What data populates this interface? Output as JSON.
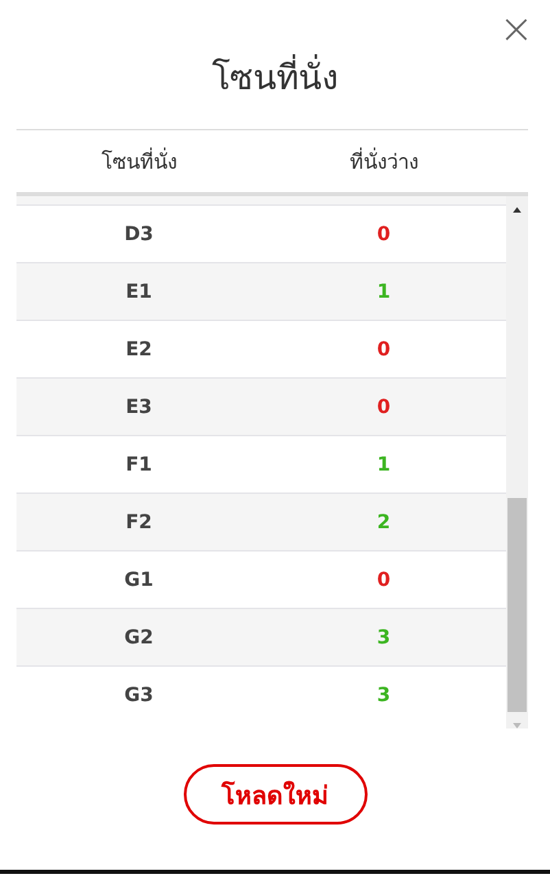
{
  "dialog": {
    "title": "โซนที่นั่ง",
    "close": "×"
  },
  "table": {
    "columns": [
      "โซนที่นั่ง",
      "ที่นั่งว่าง"
    ],
    "rows": [
      {
        "zone": "D3",
        "available": "0",
        "color": "#e02020"
      },
      {
        "zone": "E1",
        "available": "1",
        "color": "#3cb521"
      },
      {
        "zone": "E2",
        "available": "0",
        "color": "#e02020"
      },
      {
        "zone": "E3",
        "available": "0",
        "color": "#e02020"
      },
      {
        "zone": "F1",
        "available": "1",
        "color": "#3cb521"
      },
      {
        "zone": "F2",
        "available": "2",
        "color": "#3cb521"
      },
      {
        "zone": "G1",
        "available": "0",
        "color": "#e02020"
      },
      {
        "zone": "G2",
        "available": "3",
        "color": "#3cb521"
      },
      {
        "zone": "G3",
        "available": "3",
        "color": "#3cb521"
      }
    ]
  },
  "reload_button": "โหลดใหม่"
}
